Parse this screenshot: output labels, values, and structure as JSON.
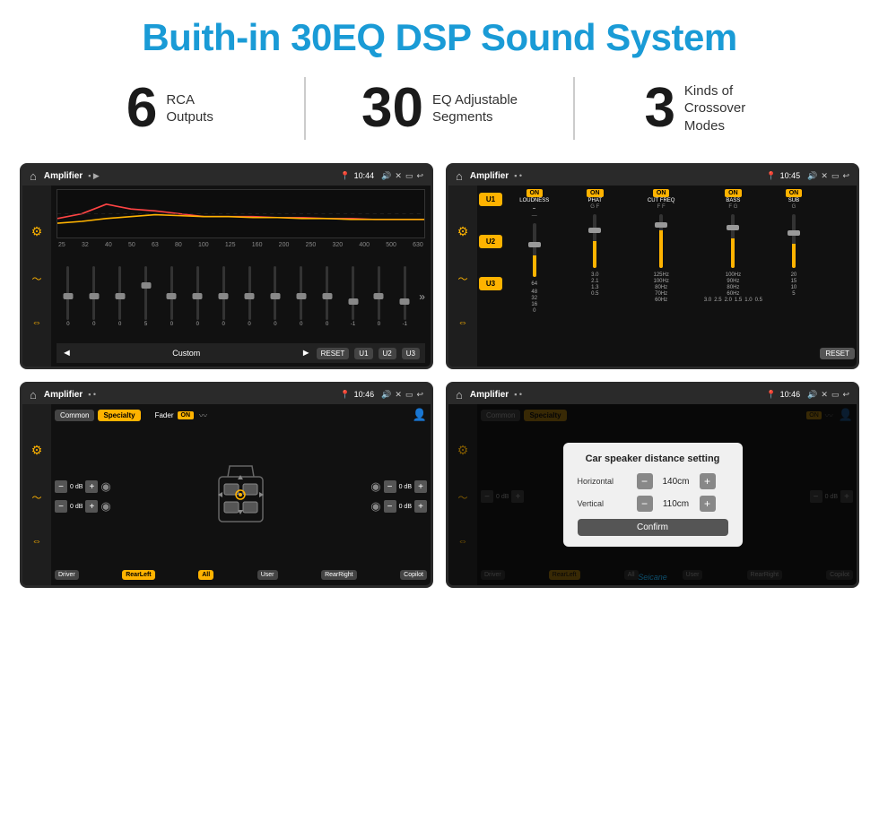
{
  "header": {
    "title": "Buith-in 30EQ DSP Sound System"
  },
  "stats": [
    {
      "number": "6",
      "label": "RCA\nOutputs"
    },
    {
      "number": "30",
      "label": "EQ Adjustable\nSegments"
    },
    {
      "number": "3",
      "label": "Kinds of\nCrossover Modes"
    }
  ],
  "screens": {
    "eq": {
      "title": "Amplifier",
      "time": "10:44",
      "mode_label": "Custom",
      "reset_btn": "RESET",
      "u1_btn": "U1",
      "u2_btn": "U2",
      "u3_btn": "U3",
      "freq_labels": [
        "25",
        "32",
        "40",
        "50",
        "63",
        "80",
        "100",
        "125",
        "160",
        "200",
        "250",
        "320",
        "400",
        "500",
        "630"
      ],
      "slider_vals": [
        "0",
        "0",
        "0",
        "5",
        "0",
        "0",
        "0",
        "0",
        "0",
        "0",
        "0",
        "-1",
        "0",
        "-1"
      ]
    },
    "amplifier": {
      "title": "Amplifier",
      "time": "10:45",
      "u_buttons": [
        "U1",
        "U2",
        "U3"
      ],
      "controls": [
        "LOUDNESS",
        "PHAT",
        "CUT FREQ",
        "BASS",
        "SUB"
      ],
      "reset_btn": "RESET"
    },
    "fader": {
      "title": "Amplifier",
      "time": "10:46",
      "tab_common": "Common",
      "tab_specialty": "Specialty",
      "fader_label": "Fader",
      "on_label": "ON",
      "db_values": [
        "0 dB",
        "0 dB",
        "0 dB",
        "0 dB"
      ],
      "zones": [
        "Driver",
        "RearLeft",
        "All",
        "User",
        "RearRight",
        "Copilot"
      ]
    },
    "dialog": {
      "title": "Amplifier",
      "time": "10:46",
      "tab_common": "Common",
      "tab_specialty": "Specialty",
      "on_label": "ON",
      "dialog_title": "Car speaker distance setting",
      "horizontal_label": "Horizontal",
      "horizontal_value": "140cm",
      "vertical_label": "Vertical",
      "vertical_value": "110cm",
      "confirm_btn": "Confirm",
      "db_values": [
        "0 dB",
        "0 dB"
      ],
      "zones": [
        "Driver",
        "RearLeft",
        "All",
        "User",
        "RearRight",
        "Copilot"
      ]
    }
  },
  "watermark": "Seicane"
}
